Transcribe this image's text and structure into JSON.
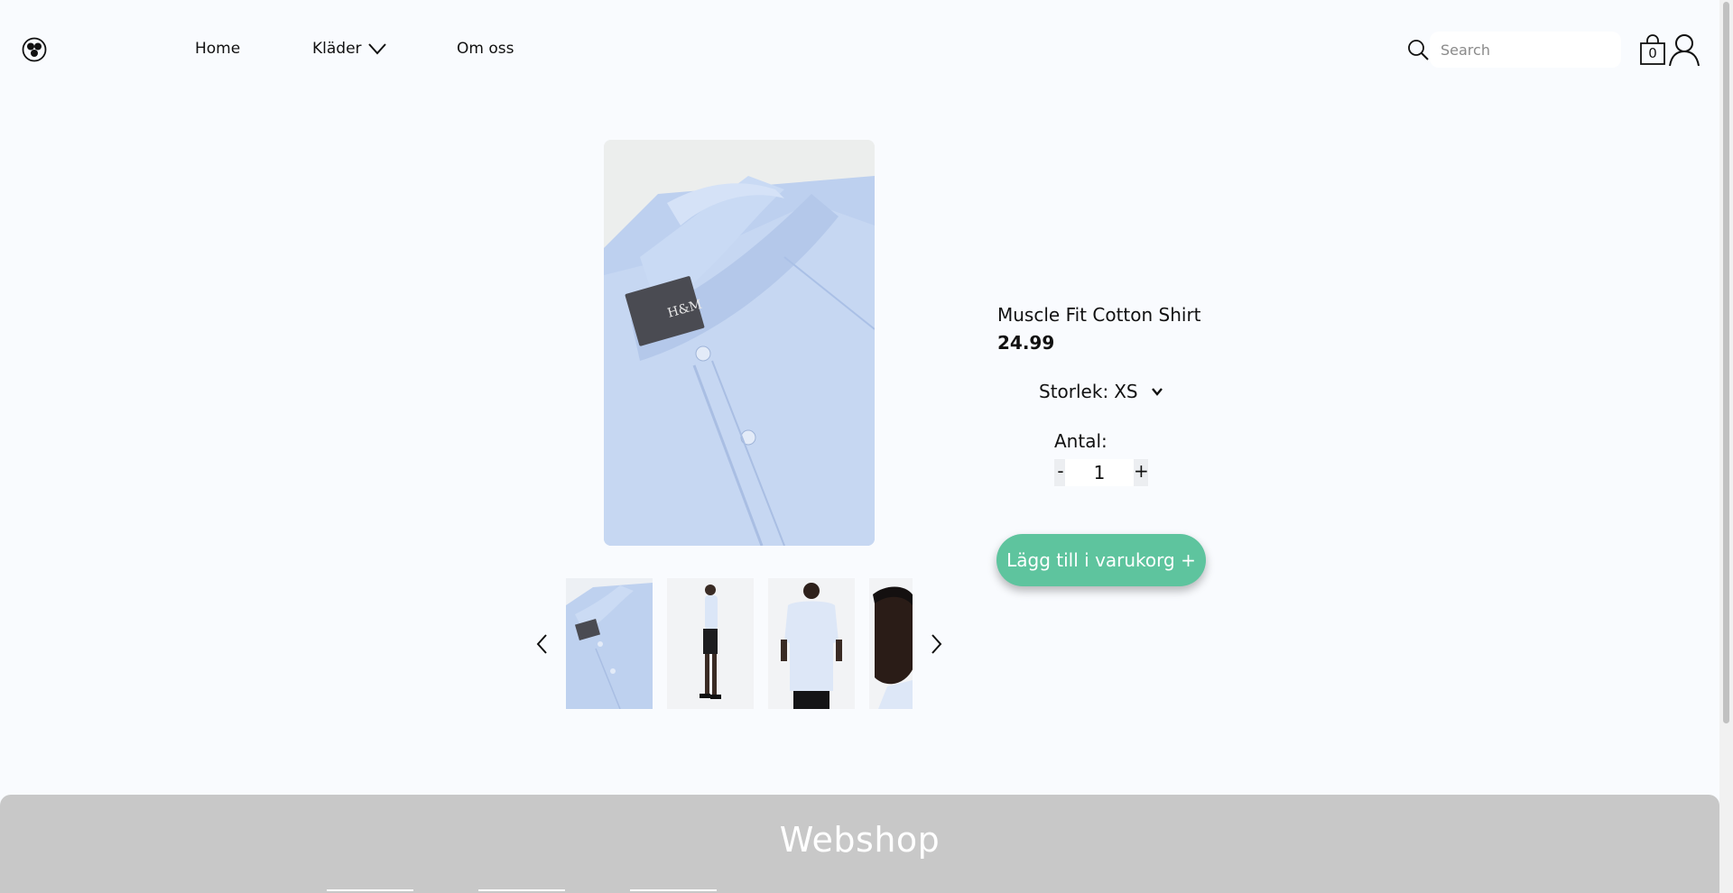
{
  "header": {
    "logo_icon": "trefoil-logo-icon",
    "nav": {
      "home": "Home",
      "clothes": "Kläder",
      "about": "Om oss"
    },
    "search": {
      "placeholder": "Search",
      "value": ""
    },
    "cart_count": "0"
  },
  "product": {
    "name": "Muscle Fit Cotton Shirt",
    "price": "24.99",
    "size_label": "Storlek:",
    "size_value": "XS",
    "quantity_label": "Antal:",
    "quantity": "1",
    "minus_label": "-",
    "plus_label": "+",
    "add_to_cart_label": "Lägg till i varukorg +",
    "thumbnails": [
      {
        "name": "collar-detail"
      },
      {
        "name": "model-side"
      },
      {
        "name": "model-back"
      },
      {
        "name": "model-face"
      }
    ]
  },
  "footer": {
    "title": "Webshop"
  },
  "colors": {
    "accent": "#5ec49e",
    "background": "#f9fbfe",
    "footer": "#c8c8c8",
    "shirt": "#bcd0ef"
  }
}
